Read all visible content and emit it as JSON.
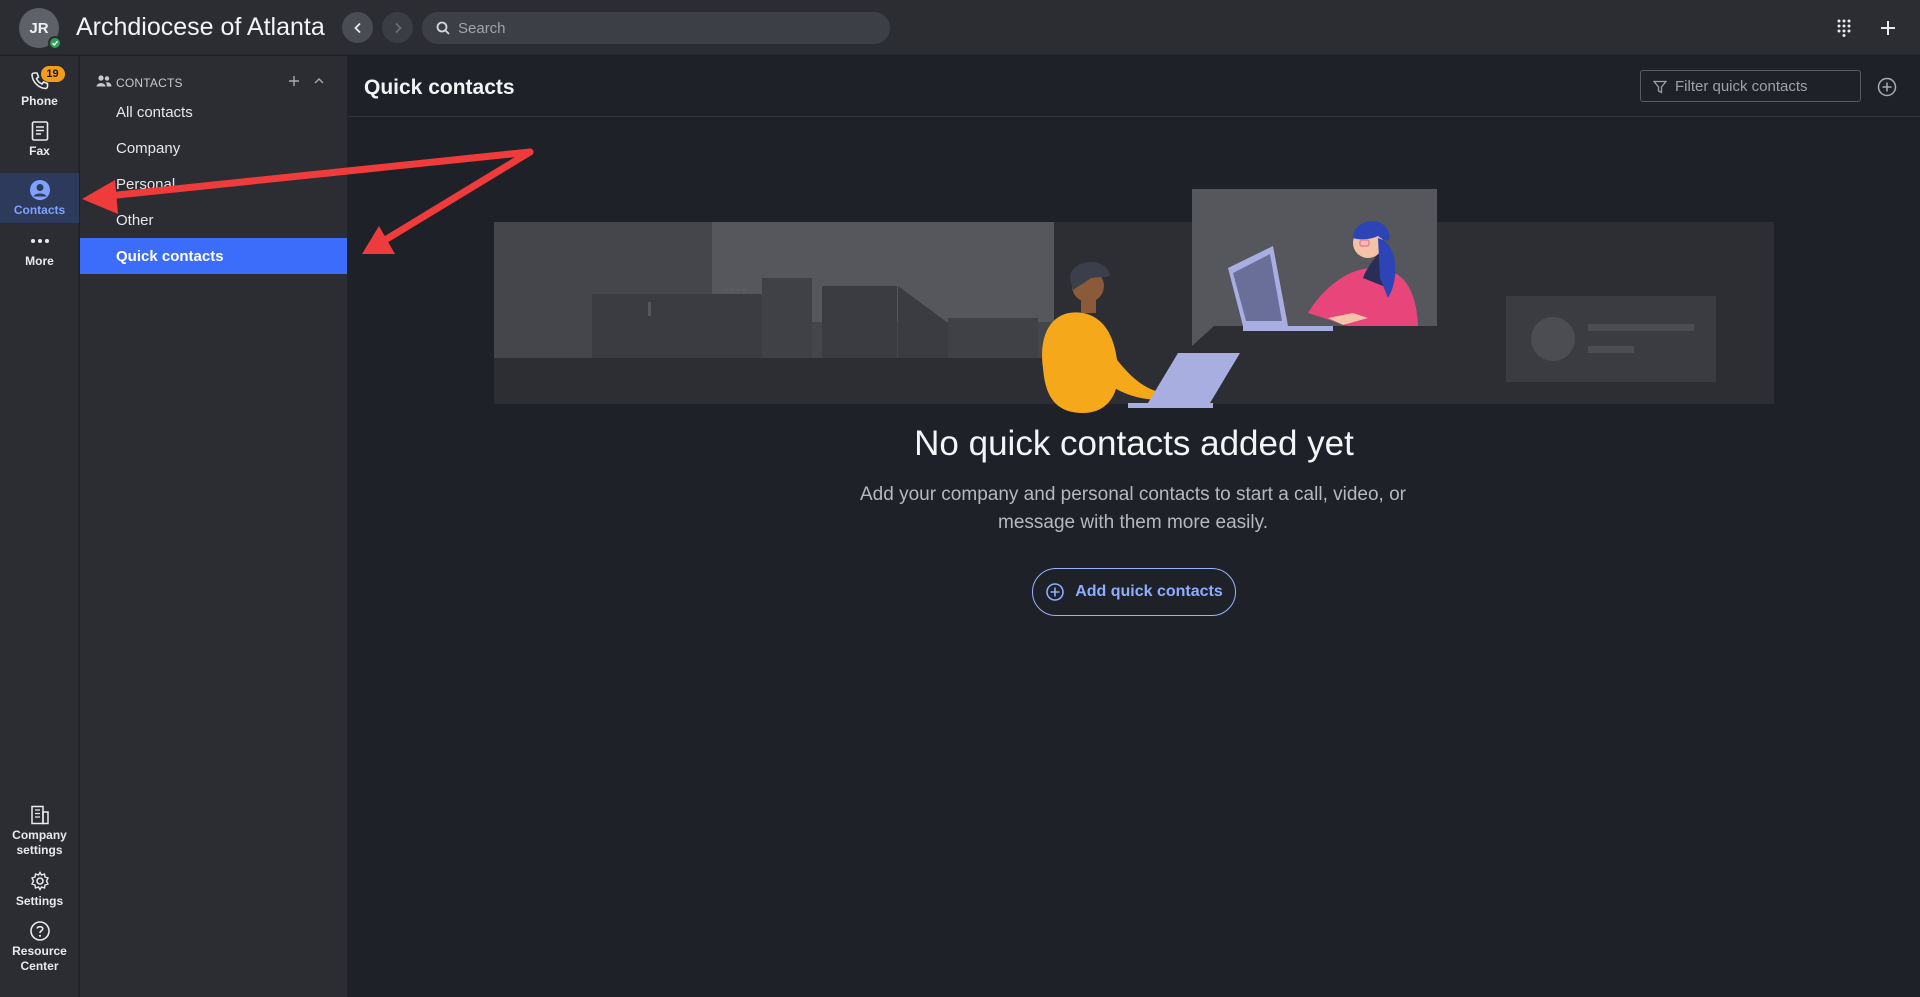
{
  "header": {
    "avatar_initials": "JR",
    "org_title": "Archdiocese of Atlanta",
    "search_placeholder": "Search",
    "back_icon": "chevron-left-icon",
    "forward_icon": "chevron-right-icon",
    "dialpad_icon": "dialpad-icon",
    "add_icon": "plus-icon"
  },
  "rail": {
    "top_items": [
      {
        "label": "Phone",
        "icon": "phone-icon",
        "badge": "19"
      },
      {
        "label": "Fax",
        "icon": "fax-icon"
      },
      {
        "label": "Contacts",
        "icon": "contacts-icon",
        "active": true
      },
      {
        "label": "More",
        "icon": "more-icon"
      }
    ],
    "bottom_items": [
      {
        "label": "Company settings",
        "icon": "building-icon"
      },
      {
        "label": "Settings",
        "icon": "gear-icon"
      },
      {
        "label": "Resource Center",
        "icon": "help-icon"
      }
    ]
  },
  "contacts_panel": {
    "title": "CONTACTS",
    "items": [
      "All contacts",
      "Company",
      "Personal",
      "Other",
      "Quick contacts"
    ],
    "selected": "Quick contacts"
  },
  "main": {
    "title": "Quick contacts",
    "filter_placeholder": "Filter quick contacts",
    "empty_title": "No quick contacts added yet",
    "empty_desc": "Add your company and personal contacts to start a call, video, or message with them more easily.",
    "add_button_label": "Add quick contacts"
  },
  "colors": {
    "accent": "#3c6dfa",
    "annotation_arrow": "#ef3b3b",
    "badge": "#f59d1b"
  }
}
